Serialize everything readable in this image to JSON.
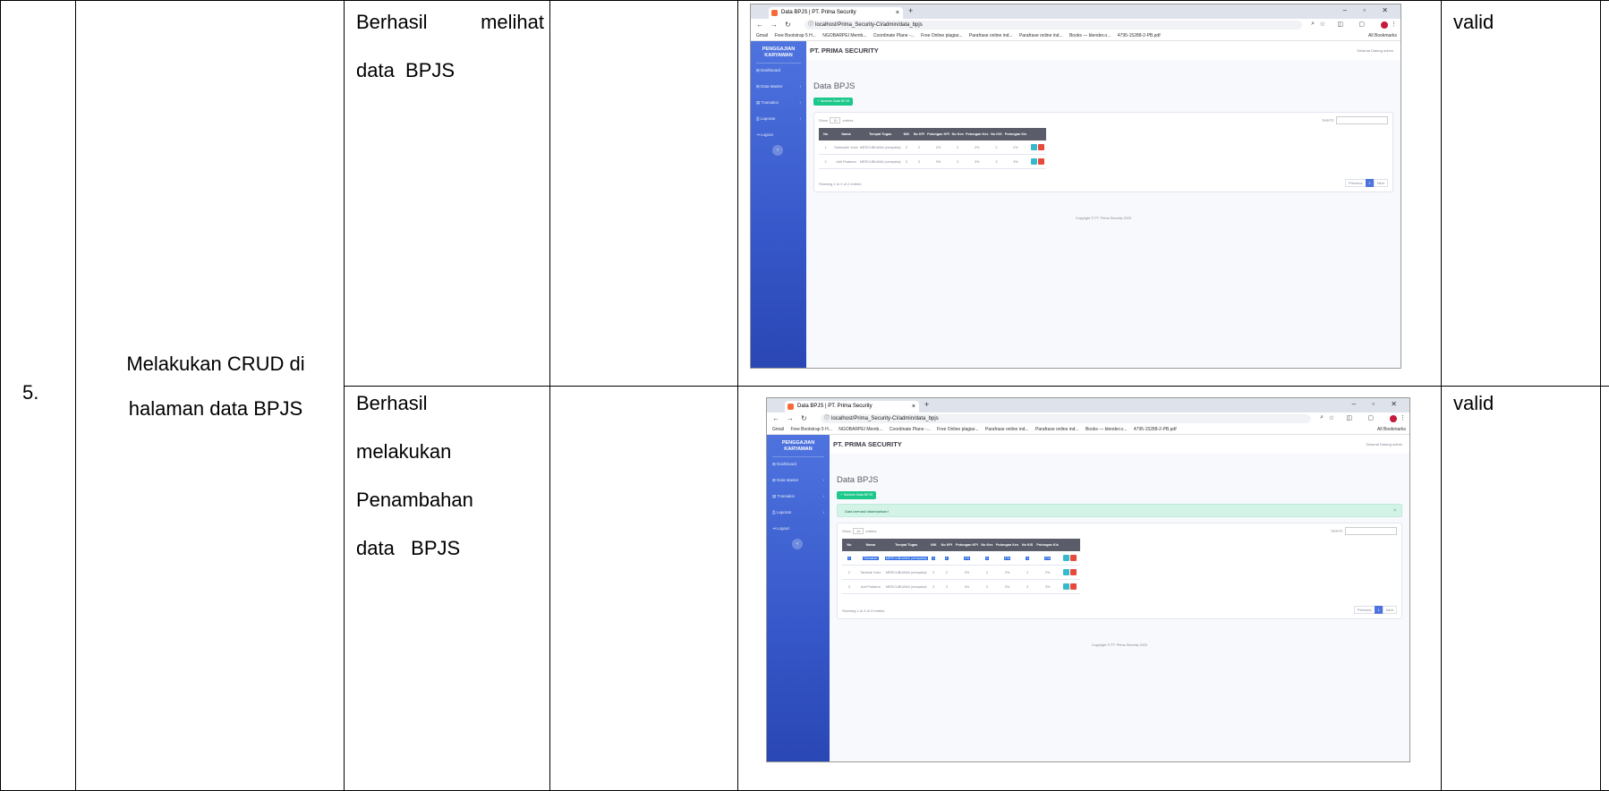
{
  "row": {
    "number": "5.",
    "scenario_line1": "Melakukan CRUD di",
    "scenario_line2": "halaman data BPJS",
    "result1_line1": "Berhasil melihat",
    "result1_line2": "data  BPJS",
    "result2_line1": "Berhasil",
    "result2_line2": "melakukan",
    "result2_line3": "Penambahan",
    "result2_line4": "data   BPJS",
    "status1": "valid",
    "status2": "valid"
  },
  "browser": {
    "tab_title": "Data BPJS | PT. Prima Security",
    "tab_close": "×",
    "new_tab": "+",
    "url1": "localhost/Prima_Security-CI/admin/data_bpjs",
    "url2": "localhost/Prima_Security-CI/admin/data_bpjs",
    "bookmarks": [
      "Gmail",
      "Free Bootstrap 5 H...",
      "NGOBARPEI Memb...",
      "Coordinate Plane -...",
      "Free Online plagiar...",
      "Parafrase online ind...",
      "Parafrase online ind...",
      "Books — blender.o...",
      "4795-15288-2-PB.pdf"
    ],
    "all_bookmarks": "All Bookmarks"
  },
  "app": {
    "brand_line1": "PENGGAJIAN",
    "brand_line2": "KARYAWAN",
    "menu": [
      "Dashboard",
      "Data Master",
      "Transaksi",
      "Laporan",
      "Logout"
    ],
    "company": "PT. PRIMA SECURITY",
    "user": "Selamat Datang admin",
    "page_title": "Data BPJS",
    "add_button": "+ Tambah Data BPJS",
    "alert": "Data berhasil ditambahkan!",
    "alert_close": "×",
    "show_label": "Show",
    "show_value": "10",
    "entries_label": "entries",
    "search_label": "Search:",
    "columns": [
      "No",
      "Nama",
      "Tempat Tugas",
      "NIK",
      "No KPI",
      "Potongan KPI",
      "No Kes",
      "Potongan Kes",
      "No KIS",
      "Potongan Kis",
      ""
    ],
    "table1_rows": [
      [
        "1",
        "Samsudin Yudo",
        "MERCUBUANA (cempaka)",
        "2",
        "2",
        "2%",
        "2",
        "2%",
        "2",
        "2%"
      ],
      [
        "2",
        "Adit Pratama",
        "MERCUBUANA (cempaka)",
        "3",
        "3",
        "3%",
        "3",
        "3%",
        "3",
        "3%"
      ]
    ],
    "table2_rows": [
      [
        "1",
        "Samarao",
        "MERCUBUANA (cempaka)",
        "1",
        "1",
        "1%",
        "1",
        "1%",
        "1",
        "1%"
      ],
      [
        "2",
        "Tambak Yudo",
        "MERCUBUANA (cempaka)",
        "2",
        "2",
        "2%",
        "2",
        "2%",
        "2",
        "2%"
      ],
      [
        "3",
        "Anil Pratama",
        "MERCUBUANA (cempaka)",
        "3",
        "3",
        "3%",
        "3",
        "3%",
        "3",
        "3%"
      ]
    ],
    "info1": "Showing 1 to 2 of 2 entries",
    "info2": "Showing 1 to 3 of 3 entries",
    "prev": "Previous",
    "page": "1",
    "next": "Next",
    "copyright": "Copyright © PT. Prima Security 2023"
  }
}
